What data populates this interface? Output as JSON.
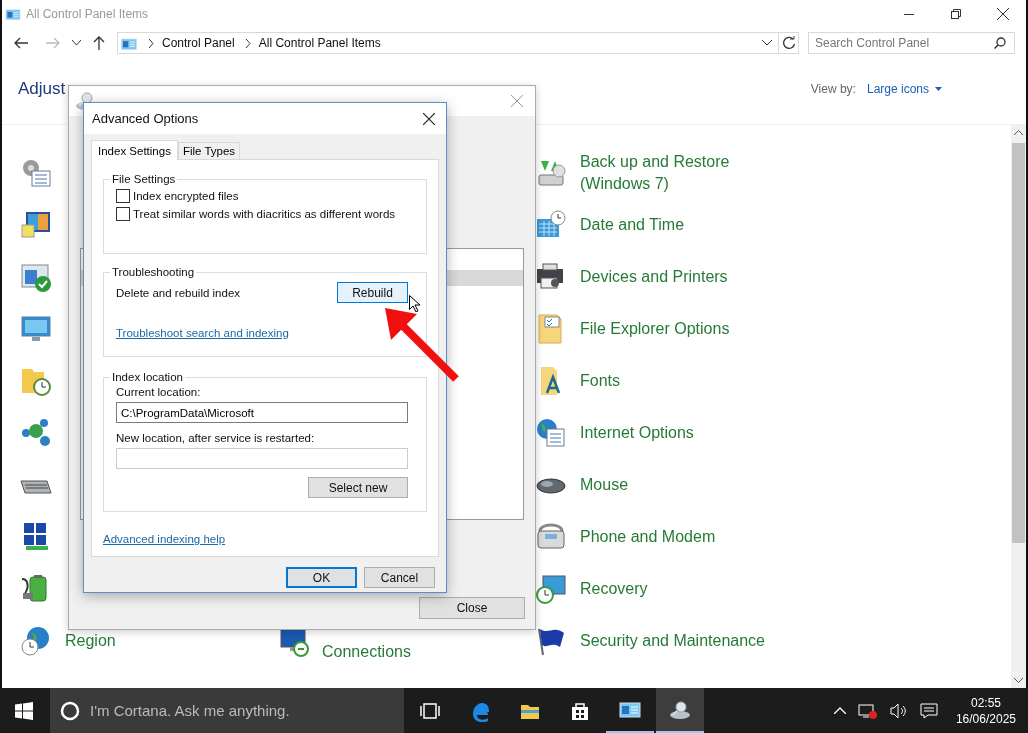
{
  "explorer": {
    "title": "All Control Panel Items",
    "breadcrumb": [
      "Control Panel",
      "All Control Panel Items"
    ],
    "search": {
      "placeholder": "Search Control Panel"
    },
    "heading": "Adjust",
    "view_by_label": "View by:",
    "view_by_value": "Large icons"
  },
  "rows": [
    {
      "left": {
        "kind": "admin-tools"
      },
      "right": {
        "kind": "backup",
        "label": "Back up and Restore (Windows 7)"
      }
    },
    {
      "left": {
        "kind": "color"
      },
      "right": {
        "kind": "datetime",
        "label": "Date and Time"
      }
    },
    {
      "left": {
        "kind": "window-check"
      },
      "right": {
        "kind": "devices",
        "label": "Devices and Printers"
      }
    },
    {
      "left": {
        "kind": "display"
      },
      "right": {
        "kind": "folder-options",
        "label": "File Explorer Options"
      }
    },
    {
      "left": {
        "kind": "history"
      },
      "right": {
        "kind": "fonts",
        "label": "Fonts"
      }
    },
    {
      "left": {
        "kind": "homegroup"
      },
      "right": {
        "kind": "globe-list",
        "label": "Internet Options"
      }
    },
    {
      "left": {
        "kind": "keyboard"
      },
      "right": {
        "kind": "mouse",
        "label": "Mouse"
      }
    },
    {
      "left": {
        "kind": "network"
      },
      "right": {
        "kind": "phone",
        "label": "Phone and Modem"
      }
    },
    {
      "left": {
        "kind": "power"
      },
      "right": {
        "kind": "recovery",
        "label": "Recovery"
      }
    },
    {
      "left": {
        "kind": "region",
        "label": "Region"
      },
      "middle": {
        "kind": "remote",
        "label": "Connections",
        "cut_top": true
      },
      "right": {
        "kind": "flag",
        "label": "Security and Maintenance"
      }
    }
  ],
  "indexing_dialog": {
    "list_rows": [
      {
        "selected": false
      },
      {
        "selected": true
      }
    ],
    "close_button": "Close"
  },
  "advanced_dialog": {
    "title": "Advanced Options",
    "tabs": [
      {
        "label": "Index Settings",
        "selected": true
      },
      {
        "label": "File Types",
        "selected": false
      }
    ],
    "file_settings": {
      "title": "File Settings",
      "options": [
        {
          "label": "Index encrypted files",
          "checked": false
        },
        {
          "label": "Treat similar words with diacritics as different words",
          "checked": false
        }
      ]
    },
    "troubleshooting": {
      "title": "Troubleshooting",
      "text": "Delete and rebuild index",
      "button": "Rebuild",
      "button_hovered": true,
      "link": "Troubleshoot search and indexing"
    },
    "index_location": {
      "title": "Index location",
      "current_label": "Current location:",
      "current_value": "C:\\ProgramData\\Microsoft",
      "new_label": "New location, after service is restarted:",
      "button": "Select new"
    },
    "help_link": "Advanced indexing help",
    "buttons": [
      {
        "label": "OK",
        "default": true
      },
      {
        "label": "Cancel",
        "default": false
      }
    ]
  },
  "taskbar": {
    "search_placeholder": "I'm Cortana. Ask me anything.",
    "apps": [
      {
        "kind": "task-view",
        "running": false,
        "selected": false
      },
      {
        "kind": "edge",
        "running": false,
        "selected": false
      },
      {
        "kind": "explorer",
        "running": false,
        "selected": false
      },
      {
        "kind": "store",
        "running": false,
        "selected": false
      },
      {
        "kind": "control-panel",
        "running": true,
        "selected": false
      },
      {
        "kind": "indexing",
        "running": true,
        "selected": true
      }
    ],
    "time": "02:55",
    "date": "16/06/2025"
  }
}
